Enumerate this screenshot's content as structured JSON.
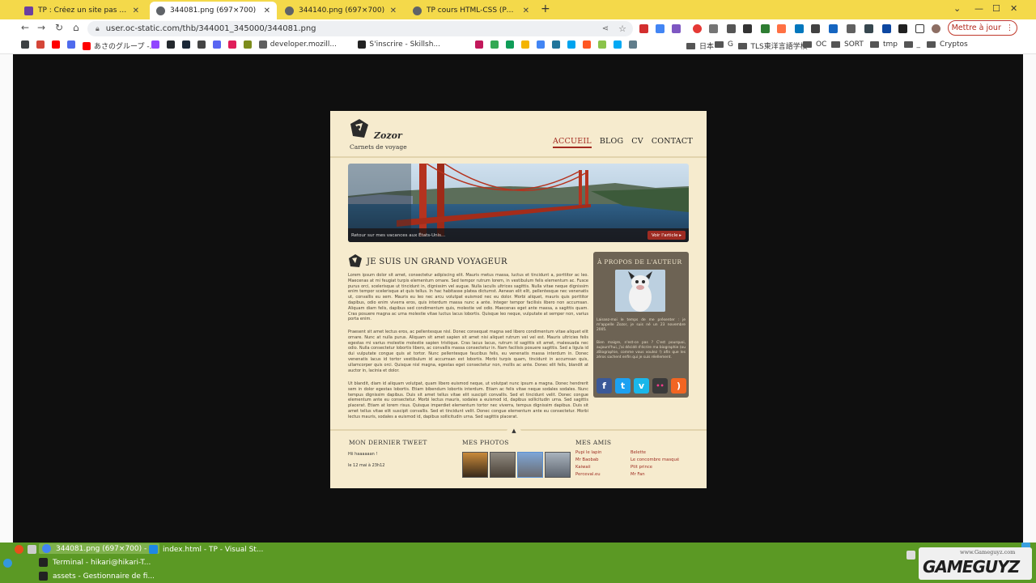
{
  "browser": {
    "tabs": [
      {
        "label": "TP : Créez un site pas à pas - A",
        "color": "#6b3fa0"
      },
      {
        "label": "344081.png (697×700)",
        "color": "#5f6368"
      },
      {
        "label": "344140.png (697×700)",
        "color": "#5f6368"
      },
      {
        "label": "TP cours HTML-CSS (Partie03)",
        "color": "#5f6368"
      }
    ],
    "url": "user.oc-static.com/thb/344001_345000/344081.png",
    "update_label": "Mettre à jour",
    "bookmarks": [
      {
        "label": "",
        "color": "#3c4043"
      },
      {
        "label": "",
        "color": "#d44638"
      },
      {
        "label": "",
        "color": "#ff0000"
      },
      {
        "label": "",
        "color": "#4f6bed"
      },
      {
        "label": "あさのグループ -...",
        "color": "#ff0000"
      },
      {
        "label": "",
        "color": "#9146ff"
      },
      {
        "label": "",
        "color": "#24292e"
      },
      {
        "label": "",
        "color": "#1b2838"
      },
      {
        "label": "",
        "color": "#444444"
      },
      {
        "label": "",
        "color": "#5865f2"
      },
      {
        "label": "",
        "color": "#e01e5a"
      },
      {
        "label": "",
        "color": "#7c8c1c"
      },
      {
        "label": "developer.mozill...",
        "color": "#5f5f5f"
      },
      {
        "label": "S'inscrire - Skillsh...",
        "color": "#222222"
      },
      {
        "label": "",
        "color": "#c2185b"
      },
      {
        "label": "",
        "color": "#34a853"
      },
      {
        "label": "",
        "color": "#0f9d58"
      },
      {
        "label": "",
        "color": "#f4b400"
      },
      {
        "label": "",
        "color": "#4285f4"
      },
      {
        "label": "",
        "color": "#21759b"
      },
      {
        "label": "",
        "color": "#00a4ef"
      },
      {
        "label": "",
        "color": "#ff5722"
      },
      {
        "label": "",
        "color": "#8bc34a"
      },
      {
        "label": "",
        "color": "#03a9f4"
      },
      {
        "label": "",
        "color": "#607d8b"
      }
    ],
    "bookmark_folders": [
      "日本",
      "G",
      "TLS東洋言語学校",
      "OC",
      "SORT",
      "tmp",
      "_",
      "Cryptos"
    ]
  },
  "site": {
    "logo_name": "Zozor",
    "tagline": "Carnets de voyage",
    "nav": [
      "ACCUEIL",
      "BLOG",
      "CV",
      "CONTACT"
    ],
    "banner_caption": "Retour sur mes vacances aux États-Unis...",
    "banner_button": "Voir l'article ▸",
    "article_title": "JE SUIS UN GRAND VOYAGEUR",
    "paragraphs": [
      "Lorem ipsum dolor sit amet, consectetur adipiscing elit. Mauris metus massa, luctus et tincidunt a, porttitor ac leo. Maecenas at mi feugiat turpis elementum ornare. Sed tempor rutrum lorem, in vestibulum felis elementum ac. Fusce purus orci, scelerisque ut tincidunt in, dignissim vel augue. Nulla iaculis ultrices sagittis. Nulla vitae neque dignissim enim tempor scelerisque at quis tellus. In hac habitasse platea dictumst. Aenean elit elit, pellentesque nec venenatis ut, convallis eu sem. Mauris eu leo nec arcu volutpat euismod nec eu dolor. Morbi aliquet, mauris quis porttitor dapibus, odio enim viverra eros, quis interdum massa nunc a ante. Integer tempor facilisis libero non accumsan. Aliquam diam felis, dapibus sed condimentum quis, molestie vel odio. Maecenas eget ante massa, a sagittis quam. Cras posuere magna ac urna molestie vitae luctus lacus lobortis. Quisque leo neque, vulputate at semper non, varius porta enim.",
      "Praesent sit amet lectus eros, ac pellentesque nisl. Donec consequat magna sed libero condimentum vitae aliquet elit ornare. Nunc at nulla purus. Aliquam sit amet sapien sit amet nisi aliquet rutrum vel vel est. Mauris ultricies felis egestas mi varius molestie molestie sapien tristique. Cras lacus lacus, rutrum id sagittis sit amet, malesuada nec odio. Nulla consectetur lobortis libero, ac convallis massa consectetur in. Nam facilisis posuere sagittis. Sed a ligula id dui vulputate congue quis at tortor. Nunc pellentesque faucibus felis, eu venenatis massa interdum in. Donec venenatis lacus id tortor vestibulum id accumsan est lobortis. Morbi turpis quam, tincidunt in accumsan quis, ullamcorper quis orci. Quisque nisl magna, egestas eget consectetur non, mollis ac ante. Donec elit felis, blandit at auctor in, lacinia et dolor.",
      "Ut blandit, diam id aliquam volutpat, quam libero euismod neque, ut volutpat nunc ipsum a magna. Donec hendrerit sem in dolor egestas lobortis. Etiam bibendum lobortis interdum. Etiam ac felis vitae neque sodales sodales. Nunc tempus dignissim dapibus. Duis sit amet tellus vitae elit suscipit convallis. Sed et tincidunt velit. Donec congue elementum ante eu consectetur. Morbi lectus mauris, sodales a euismod id, dapibus sollicitudin urna. Sed sagittis placerat. Etiam at lorem risus. Quisque imperdiet elementum tortor nec viverra, tempus dignissim dapibus. Duis sit amet tellus vitae elit suscipit convallis. Sed et tincidunt velit. Donec congue elementum ante eu consectetur. Morbi lectus mauris, sodales a euismod id, dapibus sollicitudin urna. Sed sagittis placerat."
    ],
    "aside_title": "À PROPOS DE L'AUTEUR",
    "aside_text_1": "Laissez-moi le temps de me présenter : je m'appelle Zozor, je suis né un 23 novembre 2005.",
    "aside_text_2": "Bien maigre, n'est-ce pas ? C'est pourquoi, aujourd'hui, j'ai décidé d'écrire ma biographie (ou zBiographie, comme vous voulez !) afin que les zéros sachent enfin qui je suis réellement.",
    "social": [
      {
        "name": "facebook-icon",
        "glyph": "f",
        "color": "#3b5998"
      },
      {
        "name": "twitter-icon",
        "glyph": "t",
        "color": "#1da1f2"
      },
      {
        "name": "vimeo-icon",
        "glyph": "v",
        "color": "#1ab7ea"
      },
      {
        "name": "flickr-icon",
        "glyph": "••",
        "color": "#3a3a3a"
      },
      {
        "name": "rss-icon",
        "glyph": ")",
        "color": "#f26522"
      }
    ],
    "footer": {
      "tweet_title": "MON DERNIER TWEET",
      "tweet_text": "Hii haaaaaan !",
      "tweet_date": "le 12 mai à 23h12",
      "photos_title": "MES PHOTOS",
      "friends_title": "MES AMIS",
      "friends_col1": [
        "Pupi le lapin",
        "Mr Baobab",
        "Kaiwaii",
        "Perceval.eu"
      ],
      "friends_col2": [
        "Belette",
        "Le concombre masqué",
        "Ptit prince",
        "Mr Fan"
      ]
    }
  },
  "taskbar": {
    "active_window": "344081.png (697×700) - ...",
    "vscode": "index.html - TP - Visual St...",
    "terminal": "Terminal - hikari@hikari-T...",
    "files": "assets - Gestionnaire de fi..."
  },
  "watermark": {
    "url": "www.Gameguyz.com",
    "text": "GAMEGUYZ"
  }
}
